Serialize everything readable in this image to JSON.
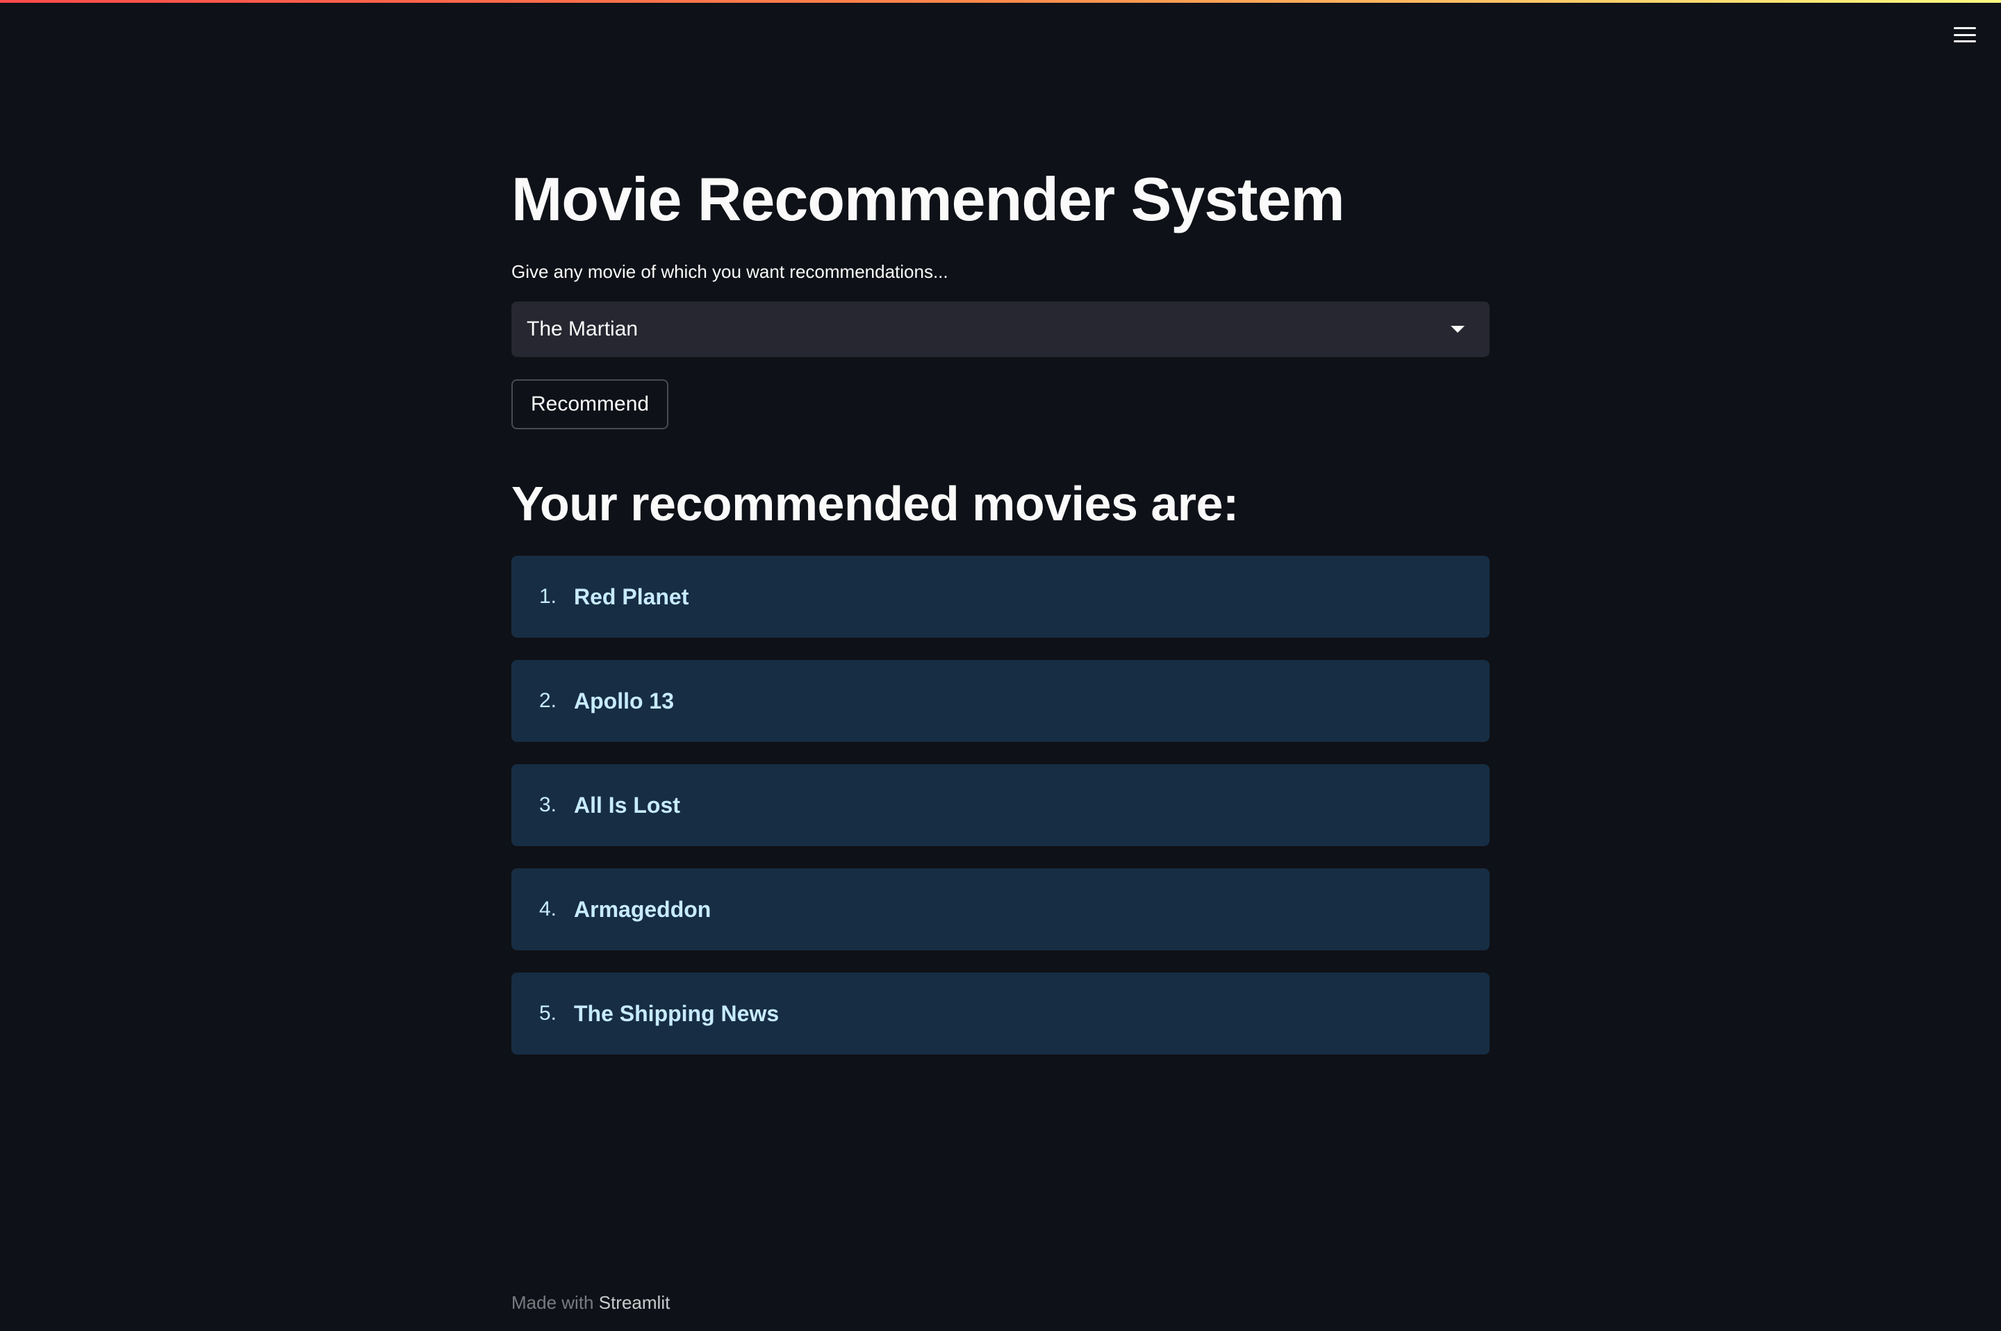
{
  "app": {
    "title": "Movie Recommender System",
    "accent_colors": {
      "background": "#0e1117",
      "select_bg": "#262730",
      "info_bg": "#172d43",
      "info_text": "#c7ebff",
      "decoration_start": "#ff4b4b",
      "decoration_end": "#fffd80"
    }
  },
  "header": {
    "menu_icon": "hamburger-menu-icon"
  },
  "select": {
    "label": "Give any movie of which you want recommendations...",
    "value": "The Martian",
    "icon": "caret-down-icon"
  },
  "recommend_button": {
    "label": "Recommend"
  },
  "results": {
    "heading": "Your recommended movies are:",
    "items": [
      {
        "num": "1.",
        "title": "Red Planet"
      },
      {
        "num": "2.",
        "title": "Apollo 13"
      },
      {
        "num": "3.",
        "title": "All Is Lost"
      },
      {
        "num": "4.",
        "title": "Armageddon"
      },
      {
        "num": "5.",
        "title": "The Shipping News"
      }
    ]
  },
  "footer": {
    "made_with": "Made with",
    "brand": "Streamlit"
  }
}
